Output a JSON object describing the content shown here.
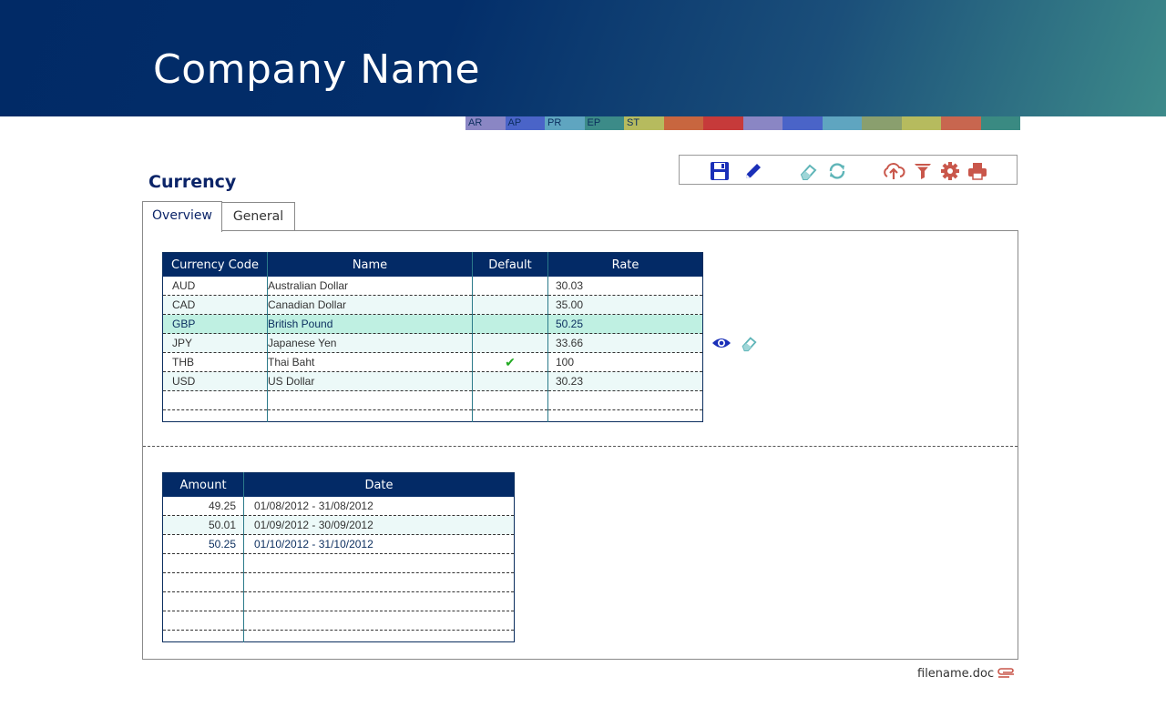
{
  "header": {
    "company_name": "Company Name"
  },
  "modules": [
    {
      "label": "AR",
      "color": "#8a86c4"
    },
    {
      "label": "AP",
      "color": "#4a64c8"
    },
    {
      "label": "PR",
      "color": "#5fa5c0"
    },
    {
      "label": "EP",
      "color": "#3c8b88"
    },
    {
      "label": "ST",
      "color": "#b6bb5e"
    },
    {
      "label": "",
      "color": "#c8663f"
    },
    {
      "label": "",
      "color": "#c63a3a"
    },
    {
      "label": "",
      "color": "#8a86c4"
    },
    {
      "label": "",
      "color": "#4a64c8"
    },
    {
      "label": "",
      "color": "#5fa5c0"
    },
    {
      "label": "",
      "color": "#8a9f6e"
    },
    {
      "label": "",
      "color": "#b6bb5e"
    },
    {
      "label": "",
      "color": "#c8664f"
    },
    {
      "label": "",
      "color": "#3a8a82"
    }
  ],
  "page": {
    "title": "Currency"
  },
  "toolbar": {
    "icons": [
      "save-icon",
      "edit-icon",
      "eraser-icon",
      "refresh-icon",
      "upload-icon",
      "filter-icon",
      "settings-icon",
      "print-icon"
    ]
  },
  "tabs": {
    "overview": "Overview",
    "general": "General"
  },
  "currency_grid": {
    "headers": {
      "code": "Currency Code",
      "name": "Name",
      "default": "Default",
      "rate": "Rate"
    },
    "rows": [
      {
        "code": "AUD",
        "name": "Australian Dollar",
        "default": "",
        "rate": "30.03"
      },
      {
        "code": "CAD",
        "name": "Canadian Dollar",
        "default": "",
        "rate": "35.00"
      },
      {
        "code": "GBP",
        "name": "British Pound",
        "default": "",
        "rate": "50.25"
      },
      {
        "code": "JPY",
        "name": "Japanese Yen",
        "default": "",
        "rate": "33.66"
      },
      {
        "code": "THB",
        "name": "Thai Baht",
        "default": "✔",
        "rate": "100"
      },
      {
        "code": "USD",
        "name": "US Dollar",
        "default": "",
        "rate": "30.23"
      }
    ]
  },
  "history_grid": {
    "headers": {
      "amount": "Amount",
      "date": "Date"
    },
    "rows": [
      {
        "amount": "49.25",
        "date": "01/08/2012 - 31/08/2012"
      },
      {
        "amount": "50.01",
        "date": "01/09/2012 - 30/09/2012"
      },
      {
        "amount": "50.25",
        "date": "01/10/2012 - 31/10/2012"
      }
    ]
  },
  "footer": {
    "filename": "filename.doc"
  },
  "colors": {
    "header_dark": "#012a66",
    "accent_red": "#c9574b",
    "accent_teal": "#5fb5b8",
    "accent_blue": "#1a2fb8"
  }
}
